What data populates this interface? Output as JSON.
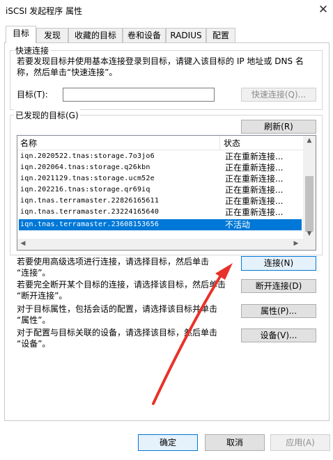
{
  "window": {
    "title": "iSCSI 发起程序 属性",
    "close_glyph": "✕"
  },
  "tabs": [
    {
      "label": "目标",
      "active": true
    },
    {
      "label": "发现"
    },
    {
      "label": "收藏的目标"
    },
    {
      "label": "卷和设备"
    },
    {
      "label": "RADIUS"
    },
    {
      "label": "配置"
    }
  ],
  "quick_connect": {
    "group_label": "快速连接",
    "description_line1": "若要发现目标并使用基本连接登录到目标，请键入该目标的 IP 地址或 DNS 名",
    "description_line2": "称，然后单击“快速连接”。",
    "target_label": "目标(T):",
    "target_value": "",
    "quick_connect_button": "快速连接(Q)..."
  },
  "discovered": {
    "group_label": "已发现的目标(G)",
    "refresh_button": "刷新(R)",
    "columns": [
      "名称",
      "状态"
    ],
    "rows": [
      {
        "name": "iqn.2020522.tnas:storage.7o3jo6",
        "status": "正在重新连接..."
      },
      {
        "name": "iqn.202064.tnas:storage.q26kbn",
        "status": "正在重新连接..."
      },
      {
        "name": "iqn.2021129.tnas:storage.ucm52e",
        "status": "正在重新连接..."
      },
      {
        "name": "iqn.202216.tnas:storage.qr69iq",
        "status": "正在重新连接..."
      },
      {
        "name": "iqn.tnas.terramaster.22826165611",
        "status": "正在重新连接..."
      },
      {
        "name": "iqn.tnas.terramaster.23224165640",
        "status": "正在重新连接..."
      },
      {
        "name": "iqn.tnas.terramaster.23608153656",
        "status": "不活动",
        "selected": true
      }
    ]
  },
  "actions": {
    "connect_text1": "若要使用高级选项进行连接，请选择目标，然后单击",
    "connect_text2": "“连接”。",
    "connect_button": "连接(N)",
    "disconnect_text1": "若要完全断开某个目标的连接，请选择该目标，然后单击",
    "disconnect_text2": "“断开连接”。",
    "disconnect_button": "断开连接(D)",
    "props_text1": "对于目标属性，包括会话的配置，请选择该目标并单击",
    "props_text2": "“属性”。",
    "props_button": "属性(P)...",
    "devices_text1": "对于配置与目标关联的设备，请选择该目标，然后单击",
    "devices_text2": "“设备”。",
    "devices_button": "设备(V)..."
  },
  "footer": {
    "ok": "确定",
    "cancel": "取消",
    "apply": "应用(A)"
  },
  "colors": {
    "accent": "#0078d7",
    "annotation_arrow": "#e8322a"
  }
}
